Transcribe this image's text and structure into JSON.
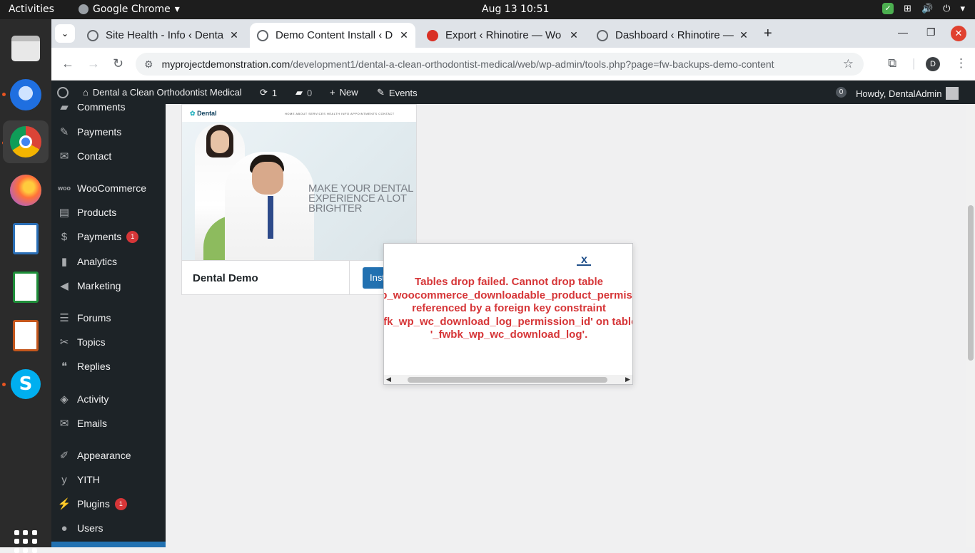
{
  "os": {
    "activities": "Activities",
    "app_menu": "Google Chrome",
    "clock": "Aug 13  10:51"
  },
  "browser": {
    "tabs": [
      {
        "title": "Site Health - Info ‹ Denta"
      },
      {
        "title": "Demo Content Install ‹ D"
      },
      {
        "title": "Export ‹ Rhinotire — Wo"
      },
      {
        "title": "Dashboard ‹ Rhinotire —"
      }
    ],
    "url_host": "myprojectdemonstration.com",
    "url_path": "/development1/dental-a-clean-orthodontist-medical/web/wp-admin/tools.php?page=fw-backups-demo-content",
    "profile_initial": "D"
  },
  "admin_bar": {
    "site_name": "Dental a Clean Orthodontist Medical",
    "updates_count": "1",
    "comments_count": "0",
    "new_label": "New",
    "events_label": "Events",
    "notifications_count": "0",
    "greeting": "Howdy, DentalAdmin"
  },
  "sidebar": {
    "items": [
      {
        "label": "Comments",
        "icon": "comments-icon"
      },
      {
        "label": "Payments",
        "icon": "payments-icon"
      },
      {
        "label": "Contact",
        "icon": "mail-icon"
      },
      {
        "label": "WooCommerce",
        "icon": "woo-icon"
      },
      {
        "label": "Products",
        "icon": "archive-icon"
      },
      {
        "label": "Payments",
        "icon": "dollar-icon",
        "badge": "1"
      },
      {
        "label": "Analytics",
        "icon": "bar-chart-icon"
      },
      {
        "label": "Marketing",
        "icon": "megaphone-icon"
      },
      {
        "label": "Forums",
        "icon": "forums-icon"
      },
      {
        "label": "Topics",
        "icon": "tools-icon"
      },
      {
        "label": "Replies",
        "icon": "replies-icon"
      },
      {
        "label": "Activity",
        "icon": "activity-icon"
      },
      {
        "label": "Emails",
        "icon": "mail-icon"
      },
      {
        "label": "Appearance",
        "icon": "brush-icon"
      },
      {
        "label": "YITH",
        "icon": "yith-icon"
      },
      {
        "label": "Plugins",
        "icon": "plugin-icon",
        "badge": "1"
      },
      {
        "label": "Users",
        "icon": "users-icon"
      }
    ]
  },
  "demo": {
    "name": "Dental Demo",
    "install_label": "Inst",
    "preview_logo": "Dental",
    "preview_nav": "HOME   ABOUT   SERVICES   HEALTH INFO   APPOINTMENTS   CONTACT",
    "preview_headline": "MAKE YOUR DENTAL EXPERIENCE A LOT BRIGHTER"
  },
  "modal": {
    "close_label": "x",
    "message": "Tables drop failed. Cannot drop table 'wp_woocommerce_downloadable_product_permissions' referenced by a foreign key constraint 'fk_wp_wc_download_log_permission_id' on table '_fwbk_wp_wc_download_log'."
  },
  "colors": {
    "wp_dark": "#1d2327",
    "wp_blue": "#2271b1",
    "error_red": "#d63638",
    "ubuntu_orange": "#e95420"
  }
}
